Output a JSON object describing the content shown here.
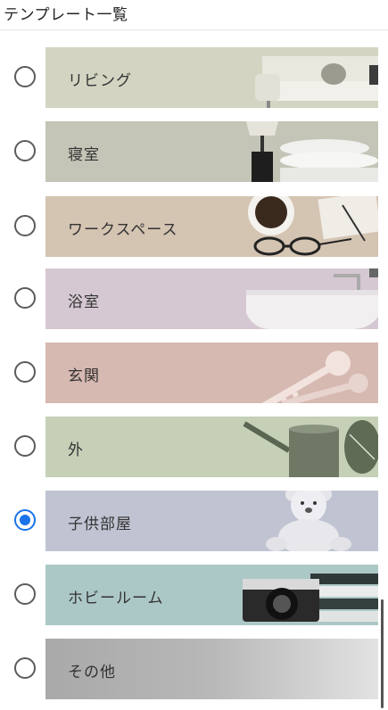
{
  "header": {
    "title": "テンプレート一覧"
  },
  "templates": [
    {
      "label": "リビング",
      "bg": "#d3d5c2",
      "icon": "sofa-icon",
      "selected": false
    },
    {
      "label": "寝室",
      "bg": "#c4c4b7",
      "icon": "bed-lamp-icon",
      "selected": false
    },
    {
      "label": "ワークスペース",
      "bg": "#d4c4b2",
      "icon": "coffee-glasses-icon",
      "selected": false
    },
    {
      "label": "浴室",
      "bg": "#d5c8d2",
      "icon": "bathtub-icon",
      "selected": false
    },
    {
      "label": "玄関",
      "bg": "#d6b9b1",
      "icon": "keys-icon",
      "selected": false
    },
    {
      "label": "外",
      "bg": "#c5d0b7",
      "icon": "watering-can-icon",
      "selected": false
    },
    {
      "label": "子供部屋",
      "bg": "#c0c4d2",
      "icon": "teddy-bear-icon",
      "selected": true
    },
    {
      "label": "ホビールーム",
      "bg": "#acc8c6",
      "icon": "camera-books-icon",
      "selected": false
    },
    {
      "label": "その他",
      "bg": "#b3b3b3",
      "icon": "",
      "selected": false
    }
  ],
  "accent_color": "#1a73e8"
}
